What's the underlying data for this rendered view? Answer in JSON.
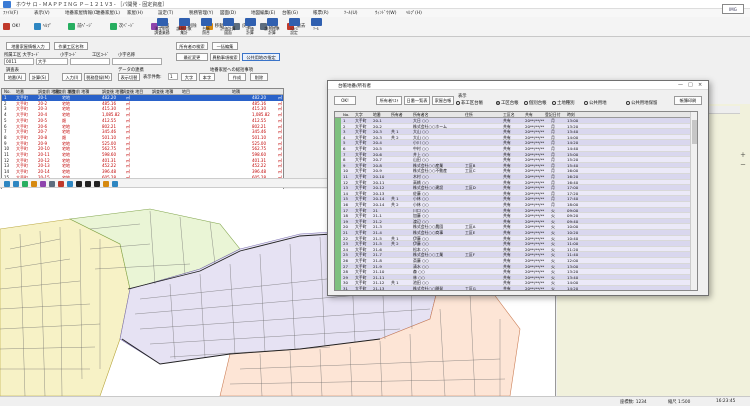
{
  "window": {
    "title": "ホウサ ロ - ＭＡＰＰＩＮＧ Ｐ－１２１Ｖ3 - ［パ開発 - 固定資産］"
  },
  "menu": [
    "ﾌｧｲﾙ(F)",
    "表示(V)",
    "地番家屋情報(C)",
    "地番家屋(L)",
    "家屋(H)",
    "設定(T)",
    "税務管理(Y)",
    "図面(D)",
    "地図編集(E)",
    "台帳(G)",
    "帳票(R)",
    "ﾂｰﾙ(U)",
    "ｳｨﾝﾄﾞｳ(W)",
    "ﾍﾙﾌﾟ(H)"
  ],
  "brand": "IMG",
  "toolbar": {
    "small": [
      "OK!",
      "ﾍﾙﾌﾟ",
      "前ﾍﾟｰｼﾞ",
      "次ﾍﾟｰｼﾞ",
      "追加",
      "削除",
      "移動",
      "戻る",
      "戻る",
      "撤去"
    ],
    "right_small": [
      "台帳参照",
      "台帳作成",
      "作業履歴"
    ],
    "big": [
      {
        "label": "法定申告\n調査業務"
      },
      {
        "label": "課税対象\n集計"
      },
      {
        "label": "台帳\n照合"
      },
      {
        "label": "評価計算\n図面"
      },
      {
        "label": "評価\n計算"
      },
      {
        "label": "課税標準\n計算"
      },
      {
        "label": "ｼｽﾃﾑ\n設定"
      },
      {
        "label": "ﾂｰﾙ"
      }
    ]
  },
  "left": {
    "top_buttons": [
      "地番家屋情報入力",
      "作業工区名称"
    ],
    "fields": {
      "area_code_label": "所属工区 大字ｺｰﾄﾞ",
      "code_label": "小字ｺｰﾄﾞ",
      "sub_code_label": "工区ｺｰﾄﾞ",
      "sub_name_label": "小字名称",
      "area_value": "0011",
      "area_name": "大手"
    },
    "mid_buttons": [
      "所有者の検索",
      "一括編集",
      "最近変更",
      "異動事項検索",
      "公共用地の指定"
    ],
    "section_labels": [
      "調査表",
      "データの連携",
      "地番家屋への総括事項"
    ],
    "row_buttons": [
      "地番(A)",
      "計算(S)",
      "入力(I)",
      "税務登録(M)",
      "表示切替",
      "表示件数:",
      "1",
      "大字",
      "本字",
      "作成",
      "削除"
    ],
    "grid": {
      "headers": [
        "No.",
        "地番",
        "調査前 地番",
        "調査前 地目",
        "調査前 地積",
        "調査後 地番",
        "調査後 地目",
        "調査後 地積",
        "地目",
        "地積"
      ],
      "rows": [
        {
          "no": "1",
          "chiban": "大手町",
          "pre": "20-1",
          "moku": "宅地",
          "area": "482.20",
          "unit": "㎡",
          "post_area": "482.20",
          "post_unit": "㎡"
        },
        {
          "no": "2",
          "chiban": "大手町",
          "pre": "20-2",
          "moku": "宅地",
          "area": "485.16",
          "unit": "㎡",
          "post_area": "485.16",
          "post_unit": "㎡"
        },
        {
          "no": "3",
          "chiban": "大手町",
          "pre": "20-3",
          "moku": "宅地",
          "area": "415.30",
          "unit": "㎡",
          "post_area": "415.30",
          "post_unit": "㎡"
        },
        {
          "no": "4",
          "chiban": "大手町",
          "pre": "20-4",
          "moku": "宅地",
          "area": "1,085.82",
          "unit": "㎡",
          "post_area": "1,085.82",
          "post_unit": "㎡"
        },
        {
          "no": "5",
          "chiban": "大手町",
          "pre": "20-5",
          "moku": "畑",
          "area": "412.55",
          "unit": "㎡",
          "post_area": "412.55",
          "post_unit": "㎡"
        },
        {
          "no": "6",
          "chiban": "大手町",
          "pre": "20-6",
          "moku": "宅地",
          "area": "802.21",
          "unit": "㎡",
          "post_area": "802.21",
          "post_unit": "㎡"
        },
        {
          "no": "7",
          "chiban": "大手町",
          "pre": "20-7",
          "moku": "宅地",
          "area": "345.46",
          "unit": "㎡",
          "post_area": "345.46",
          "post_unit": "㎡"
        },
        {
          "no": "8",
          "chiban": "大手町",
          "pre": "20-8",
          "moku": "畑",
          "area": "501.10",
          "unit": "㎡",
          "post_area": "501.10",
          "post_unit": "㎡"
        },
        {
          "no": "9",
          "chiban": "大手町",
          "pre": "20-9",
          "moku": "宅地",
          "area": "525.00",
          "unit": "㎡",
          "post_area": "525.00",
          "post_unit": "㎡"
        },
        {
          "no": "10",
          "chiban": "大手町",
          "pre": "20-10",
          "moku": "宅地",
          "area": "562.75",
          "unit": "㎡",
          "post_area": "562.75",
          "post_unit": "㎡"
        },
        {
          "no": "11",
          "chiban": "大手町",
          "pre": "20-11",
          "moku": "宅地",
          "area": "598.60",
          "unit": "㎡",
          "post_area": "598.60",
          "post_unit": "㎡"
        },
        {
          "no": "12",
          "chiban": "大手町",
          "pre": "20-12",
          "moku": "宅地",
          "area": "401.31",
          "unit": "㎡",
          "post_area": "401.31",
          "post_unit": "㎡"
        },
        {
          "no": "13",
          "chiban": "大手町",
          "pre": "20-13",
          "moku": "宅地",
          "area": "452.22",
          "unit": "㎡",
          "post_area": "452.22",
          "post_unit": "㎡"
        },
        {
          "no": "14",
          "chiban": "大手町",
          "pre": "20-14",
          "moku": "宅地",
          "area": "396.48",
          "unit": "㎡",
          "post_area": "396.48",
          "post_unit": "㎡"
        },
        {
          "no": "15",
          "chiban": "大手町",
          "pre": "20-15",
          "moku": "宅地",
          "area": "605.28",
          "unit": "㎡",
          "post_area": "605.28",
          "post_unit": "㎡"
        }
      ]
    }
  },
  "dialog": {
    "title": "台帳地番/所有者",
    "ok": "OK!",
    "buttons": [
      "所有者ﾘｽﾄ",
      "日番一覧表",
      "家屋台帳"
    ],
    "display_label": "表示",
    "radios": [
      "非工区台帳",
      "工区台帳",
      "個別台帳",
      "土地種別",
      "公共用地",
      "公共用地保留"
    ],
    "print_button": "帳簿印刷",
    "headers": [
      "No.",
      "大字",
      "地番",
      "所有者",
      "所有者名",
      "住所",
      "工区名",
      "共有",
      "登記日付",
      "時刻"
    ],
    "rows": [
      [
        "1",
        "大手町",
        "20-1",
        "",
        "大日 ○○",
        "",
        "共有",
        "20**/**/**",
        "月",
        "13:00"
      ],
      [
        "2",
        "大手町",
        "20-2",
        "",
        "株式会社○○ホーム",
        "",
        "共有",
        "20**/**/**",
        "月",
        "13:20"
      ],
      [
        "3",
        "大手町",
        "20-3",
        "共 1",
        "大山 ○○",
        "",
        "共有",
        "20**/**/**",
        "月",
        "13:40"
      ],
      [
        "4",
        "大手町",
        "20-3",
        "共 2",
        "大山 ○○",
        "",
        "共有",
        "20**/**/**",
        "月",
        "14:00"
      ],
      [
        "5",
        "大手町",
        "20-4",
        "",
        "小川 ○○",
        "",
        "共有",
        "20**/**/**",
        "月",
        "14:20"
      ],
      [
        "6",
        "大手町",
        "20-5",
        "",
        "中村 ○○",
        "",
        "共有",
        "20**/**/**",
        "月",
        "14:40"
      ],
      [
        "7",
        "大手町",
        "20-6",
        "",
        "井上 ○○",
        "",
        "共有",
        "20**/**/**",
        "月",
        "15:00"
      ],
      [
        "8",
        "大手町",
        "20-7",
        "",
        "山田 ○○",
        "",
        "共有",
        "20**/**/**",
        "月",
        "15:20"
      ],
      [
        "9",
        "大手町",
        "20-8",
        "",
        "株式会社○○産業",
        "工区B",
        "共有",
        "20**/**/**",
        "月",
        "15:40"
      ],
      [
        "10",
        "大手町",
        "20-9",
        "",
        "株式会社○○不動産",
        "工区C",
        "共有",
        "20**/**/**",
        "月",
        "16:00"
      ],
      [
        "11",
        "大手町",
        "20-10",
        "",
        "木村 ○○",
        "",
        "共有",
        "20**/**/**",
        "月",
        "16:20"
      ],
      [
        "12",
        "大手町",
        "20-11",
        "",
        "高橋 ○○",
        "",
        "共有",
        "20**/**/**",
        "月",
        "16:40"
      ],
      [
        "13",
        "大手町",
        "20-12",
        "",
        "株式会社○○建設",
        "工区D",
        "共有",
        "20**/**/**",
        "月",
        "17:00"
      ],
      [
        "14",
        "大手町",
        "20-13",
        "",
        "佐藤 ○○",
        "",
        "共有",
        "20**/**/**",
        "月",
        "17:20"
      ],
      [
        "15",
        "大手町",
        "20-14",
        "共 1",
        "小林 ○○",
        "",
        "共有",
        "20**/**/**",
        "月",
        "17:40"
      ],
      [
        "16",
        "大手町",
        "20-14",
        "共 2",
        "小林 ○○",
        "",
        "共有",
        "20**/**/**",
        "月",
        "18:00"
      ],
      [
        "17",
        "大手町",
        "21",
        "",
        "川口 ○○",
        "",
        "共有",
        "20**/**/**",
        "火",
        "09:00"
      ],
      [
        "18",
        "大手町",
        "21-1",
        "",
        "加藤 ○○",
        "",
        "共有",
        "20**/**/**",
        "火",
        "09:20"
      ],
      [
        "19",
        "大手町",
        "21-2",
        "",
        "渡辺 ○○",
        "",
        "共有",
        "20**/**/**",
        "火",
        "09:40"
      ],
      [
        "20",
        "大手町",
        "21-3",
        "",
        "株式会社○○農園",
        "工区A",
        "共有",
        "20**/**/**",
        "火",
        "10:00"
      ],
      [
        "21",
        "大手町",
        "21-4",
        "",
        "株式会社○○商事",
        "工区E",
        "共有",
        "20**/**/**",
        "火",
        "10:20"
      ],
      [
        "22",
        "大手町",
        "21-5",
        "共 1",
        "伊藤 ○○",
        "",
        "共有",
        "20**/**/**",
        "火",
        "10:40"
      ],
      [
        "23",
        "大手町",
        "21-5",
        "共 2",
        "伊藤 ○○",
        "",
        "共有",
        "20**/**/**",
        "火",
        "11:00"
      ],
      [
        "24",
        "大手町",
        "21-6",
        "",
        "松本 ○○",
        "",
        "共有",
        "20**/**/**",
        "火",
        "11:20"
      ],
      [
        "25",
        "大手町",
        "21-7",
        "",
        "株式会社○○工業",
        "工区F",
        "共有",
        "20**/**/**",
        "火",
        "11:40"
      ],
      [
        "26",
        "大手町",
        "21-8",
        "",
        "斎藤 ○○",
        "",
        "共有",
        "20**/**/**",
        "火",
        "12:00"
      ],
      [
        "27",
        "大手町",
        "21-9",
        "",
        "清水 ○○",
        "",
        "共有",
        "20**/**/**",
        "火",
        "13:00"
      ],
      [
        "28",
        "大手町",
        "21-10",
        "",
        "森 ○○",
        "",
        "共有",
        "20**/**/**",
        "火",
        "13:20"
      ],
      [
        "29",
        "大手町",
        "21-11",
        "",
        "林 ○○",
        "",
        "共有",
        "20**/**/**",
        "火",
        "13:40"
      ],
      [
        "30",
        "大手町",
        "21-12",
        "共 1",
        "池田 ○○",
        "",
        "共有",
        "20**/**/**",
        "火",
        "14:00"
      ],
      [
        "31",
        "大手町",
        "21-13",
        "",
        "株式会社○○開発",
        "工区G",
        "共有",
        "20**/**/**",
        "火",
        "14:20"
      ]
    ]
  },
  "status": {
    "left": "",
    "coords": "座標数: 1234",
    "zoom": "縮尺 1:500",
    "time": "16:23:45"
  }
}
